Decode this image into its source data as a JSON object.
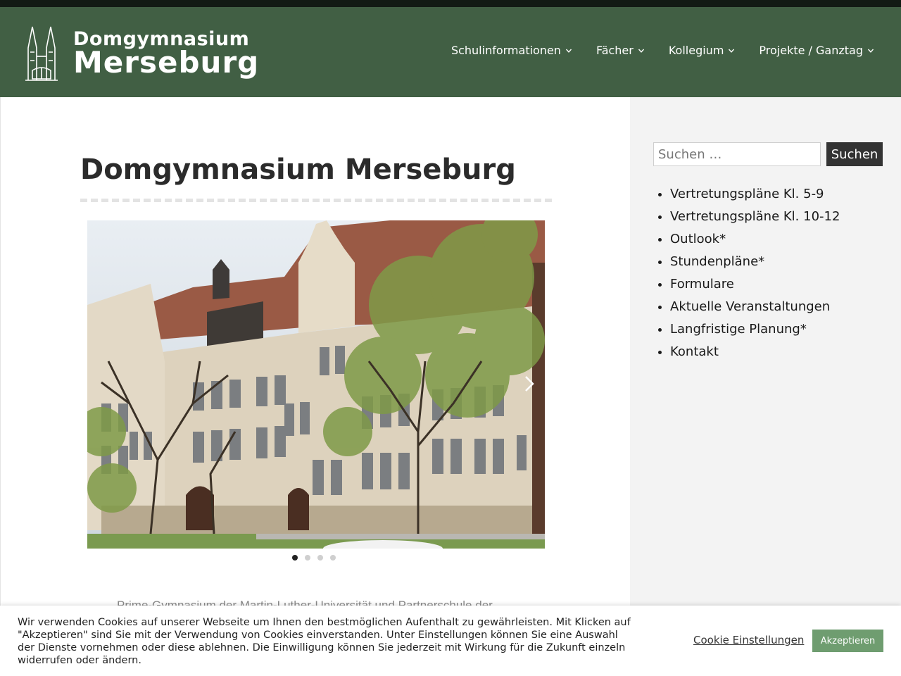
{
  "header": {
    "logo_line1": "Domgymnasium",
    "logo_line2": "Merseburg",
    "nav": [
      {
        "label": "Schulinformationen"
      },
      {
        "label": "Fächer"
      },
      {
        "label": "Kollegium"
      },
      {
        "label": "Projekte / Ganztag"
      }
    ]
  },
  "main": {
    "title": "Domgymnasium Merseburg",
    "slider": {
      "slide_count": 4,
      "active_slide": 1
    },
    "intro_text": "Prime-Gymnasium der Martin-Luther-Universität und Partnerschule der"
  },
  "sidebar": {
    "search_placeholder": "Suchen …",
    "search_button": "Suchen",
    "links": [
      "Vertretungspläne Kl. 5-9",
      "Vertretungspläne Kl. 10-12",
      "Outlook*",
      "Stundenpläne*",
      "Formulare",
      "Aktuelle Veranstaltungen",
      "Langfristige Planung*",
      "Kontakt"
    ]
  },
  "cookie": {
    "text": "Wir verwenden Cookies auf unserer Webseite um Ihnen den bestmöglichen Aufenthalt zu gewährleisten. Mit Klicken auf \"Akzeptieren\" sind Sie mit der Verwendung von Cookies einverstanden. Unter Einstellungen können Sie eine Auswahl der Dienste vornehmen oder diese ablehnen. Die Einwilligung können Sie jederzeit mit Wirkung für die Zukunft einzeln widerrufen oder ändern.",
    "settings_label": "Cookie Einstellungen",
    "accept_label": "Akzeptieren"
  },
  "colors": {
    "header_bg": "#415f44",
    "topbar": "#121a14",
    "accept_button": "#6f9d70",
    "search_button": "#333333"
  },
  "icons": [
    "cathedral-logo-icon",
    "chevron-down-icon",
    "chevron-right-icon"
  ]
}
